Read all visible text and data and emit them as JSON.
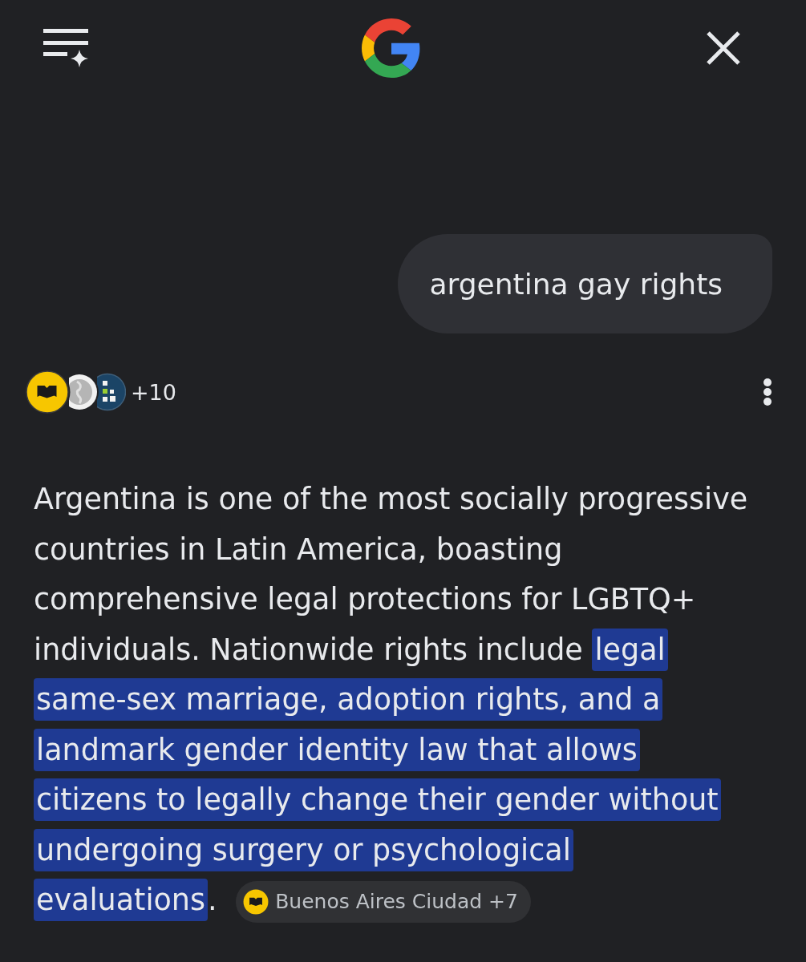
{
  "query": {
    "text": "argentina gay rights"
  },
  "sources": {
    "more": "+10"
  },
  "answer": {
    "segments": [
      {
        "text": "Argentina is one of the most socially progressive countries in Latin America, boasting comprehensive legal protections for LGBTQ+ individuals. Nationwide rights include ",
        "highlighted": false
      },
      {
        "text": "legal same-sex marriage, adoption rights, and a landmark gender identity law that allows citizens to legally change their gender without undergoing surgery or psychological evaluations",
        "highlighted": true
      },
      {
        "text": ".",
        "highlighted": false
      }
    ],
    "citation": {
      "label": "Buenos Aires Ciudad +7"
    }
  }
}
